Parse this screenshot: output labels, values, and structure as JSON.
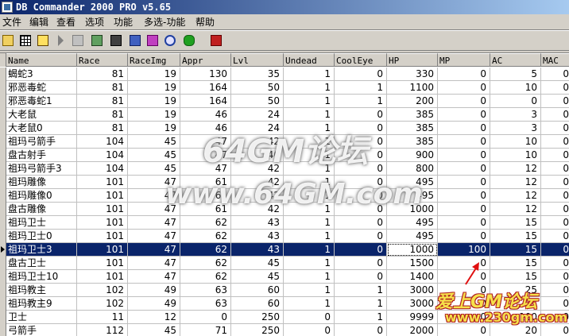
{
  "window": {
    "title": "DB Commander 2000 PRO v5.65"
  },
  "menu": [
    "文件",
    "编辑",
    "查看",
    "选项",
    "功能",
    "多选-功能",
    "帮助"
  ],
  "toolbar": {
    "icons": [
      "open-folder-icon",
      "table-grid-icon",
      "sql-icon",
      "arrow-right-icon",
      "export-icon",
      "filter-icon",
      "delete-icon",
      "database-icon",
      "info-icon",
      "search-icon",
      "run-icon",
      "exit-icon"
    ]
  },
  "grid": {
    "columns": [
      "Name",
      "Race",
      "RaceImg",
      "Appr",
      "Lvl",
      "Undead",
      "CoolEye",
      "HP",
      "MP",
      "AC",
      "MAC"
    ],
    "rows": [
      [
        "蝎蛇3",
        "81",
        "19",
        "130",
        "35",
        "1",
        "0",
        "330",
        "0",
        "5",
        "0"
      ],
      [
        "邪恶毒蛇",
        "81",
        "19",
        "164",
        "50",
        "1",
        "1",
        "1100",
        "0",
        "10",
        "0"
      ],
      [
        "邪恶毒蛇1",
        "81",
        "19",
        "164",
        "50",
        "1",
        "1",
        "200",
        "0",
        "0",
        "0"
      ],
      [
        "大老鼠",
        "81",
        "19",
        "46",
        "24",
        "1",
        "0",
        "385",
        "0",
        "3",
        "0"
      ],
      [
        "大老鼠0",
        "81",
        "19",
        "46",
        "24",
        "1",
        "0",
        "385",
        "0",
        "3",
        "0"
      ],
      [
        "祖玛弓箭手",
        "104",
        "45",
        "47",
        "42",
        "1",
        "0",
        "385",
        "0",
        "10",
        "0"
      ],
      [
        "盘古射手",
        "104",
        "45",
        "47",
        "40",
        "1",
        "0",
        "900",
        "0",
        "10",
        "0"
      ],
      [
        "祖玛弓箭手3",
        "104",
        "45",
        "47",
        "42",
        "1",
        "0",
        "800",
        "0",
        "12",
        "0"
      ],
      [
        "祖玛雕像",
        "101",
        "47",
        "61",
        "42",
        "1",
        "0",
        "495",
        "0",
        "12",
        "0"
      ],
      [
        "祖玛雕像0",
        "101",
        "47",
        "61",
        "42",
        "1",
        "0",
        "495",
        "0",
        "12",
        "0"
      ],
      [
        "盘古雕像",
        "101",
        "47",
        "61",
        "42",
        "1",
        "0",
        "1000",
        "0",
        "12",
        "0"
      ],
      [
        "祖玛卫士",
        "101",
        "47",
        "62",
        "43",
        "1",
        "0",
        "495",
        "0",
        "15",
        "0"
      ],
      [
        "祖玛卫士0",
        "101",
        "47",
        "62",
        "43",
        "1",
        "0",
        "495",
        "0",
        "15",
        "0"
      ],
      [
        "祖玛卫士3",
        "101",
        "47",
        "62",
        "43",
        "1",
        "0",
        "1000",
        "100",
        "15",
        "0"
      ],
      [
        "盘古卫士",
        "101",
        "47",
        "62",
        "45",
        "1",
        "0",
        "1500",
        "0",
        "15",
        "0"
      ],
      [
        "祖玛卫士10",
        "101",
        "47",
        "62",
        "45",
        "1",
        "0",
        "1400",
        "0",
        "15",
        "0"
      ],
      [
        "祖玛教主",
        "102",
        "49",
        "63",
        "60",
        "1",
        "1",
        "3000",
        "0",
        "25",
        "0"
      ],
      [
        "祖玛教主9",
        "102",
        "49",
        "63",
        "60",
        "1",
        "1",
        "3000",
        "0",
        "25",
        "0"
      ],
      [
        "卫士",
        "11",
        "12",
        "0",
        "250",
        "0",
        "1",
        "9999",
        "0",
        "100",
        "0"
      ],
      [
        "弓箭手",
        "112",
        "45",
        "71",
        "250",
        "0",
        "0",
        "2000",
        "0",
        "20",
        "0"
      ]
    ],
    "selected_row": 13
  },
  "watermarks": {
    "line1": "64GM论坛",
    "line2": "www.64GM.com",
    "line3": "爱上GM论坛",
    "line4": "www.230gm.com"
  },
  "colors": {
    "selection": "#0a246a",
    "title_start": "#0a246a",
    "title_end": "#a6caf0"
  }
}
